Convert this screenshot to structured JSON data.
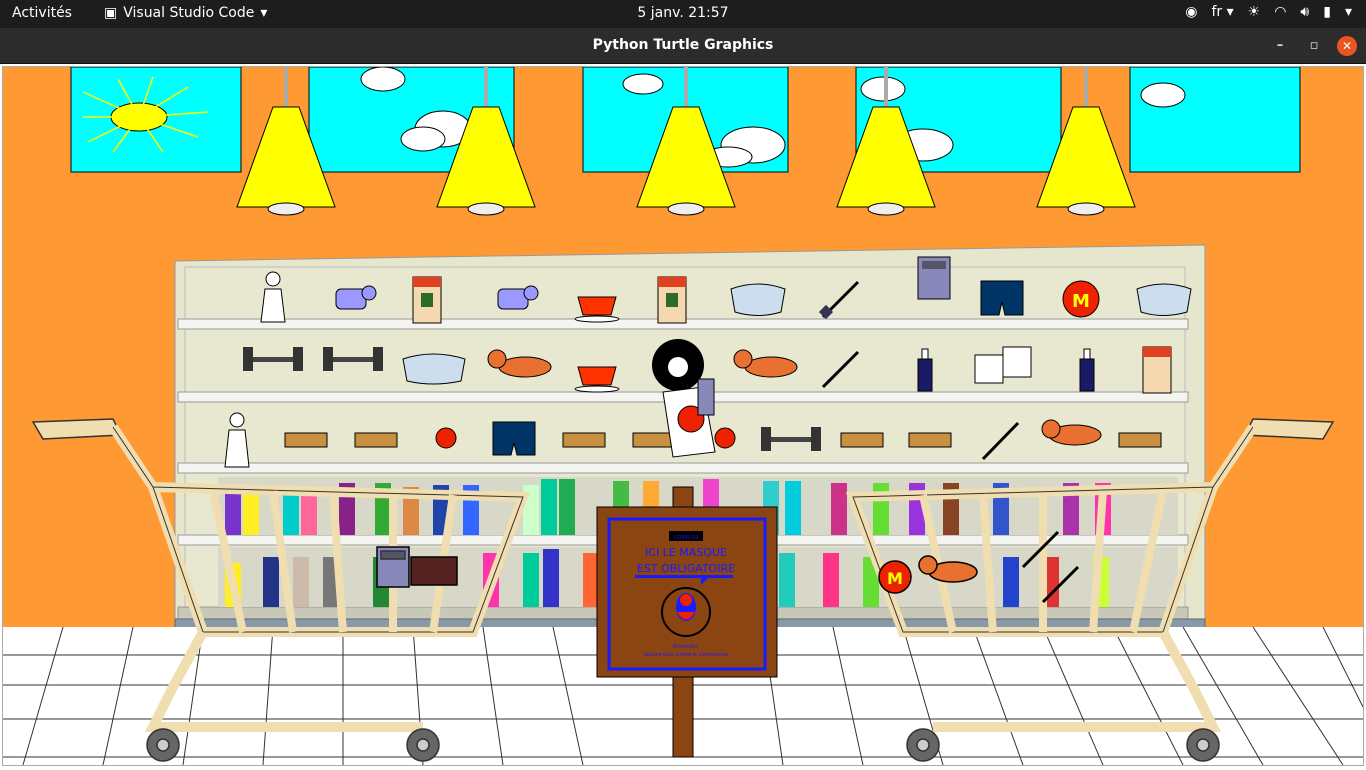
{
  "topbar": {
    "activities": "Activités",
    "app_name": "Visual Studio Code",
    "clock": "5 janv.  21:57",
    "lang": "fr"
  },
  "window": {
    "title": "Python Turtle Graphics"
  },
  "sign": {
    "badge": "COVID-19",
    "line1": "ICI LE MASQUE",
    "line2": "EST OBLIGATOIRE",
    "footer1": "Ensemble,",
    "footer2": "faisons face contre le coronavirus"
  },
  "colors": {
    "wall": "#ff9933",
    "sky": "#00ffff",
    "lamp": "#ffff00",
    "shelf": "#e6e6cc",
    "sign_board": "#8b4513",
    "cart": "#f0deb0"
  }
}
